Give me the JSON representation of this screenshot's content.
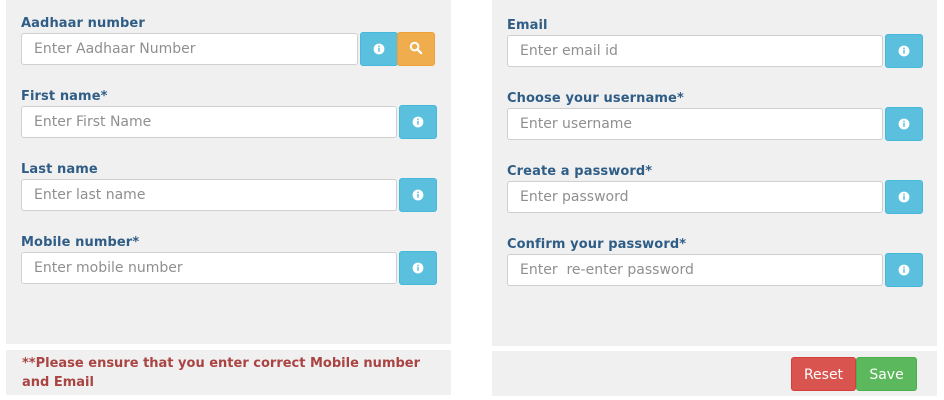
{
  "left_form": {
    "aadhaar": {
      "label": "Aadhaar number",
      "placeholder": "Enter Aadhaar Number"
    },
    "first_name": {
      "label": "First name*",
      "placeholder": "Enter First Name"
    },
    "last_name": {
      "label": "Last name",
      "placeholder": "Enter last name"
    },
    "mobile": {
      "label": "Mobile number*",
      "placeholder": "Enter mobile number"
    }
  },
  "right_form": {
    "email": {
      "label": "Email",
      "placeholder": "Enter email id"
    },
    "username": {
      "label": "Choose your username*",
      "placeholder": "Enter username"
    },
    "password": {
      "label": "Create a password*",
      "placeholder": "Enter password"
    },
    "confirm_password": {
      "label": "Confirm your password*",
      "placeholder": "Enter  re-enter password"
    }
  },
  "note": {
    "text": "**Please ensure that you enter correct Mobile number and Email"
  },
  "actions": {
    "reset_label": "Reset",
    "save_label": "Save"
  },
  "icons": {
    "info": "info-icon",
    "search": "search-icon"
  },
  "colors": {
    "label": "#2f5d86",
    "note": "#a94442",
    "info_button": "#5bc0de",
    "search_button": "#f0ad4e",
    "reset_button": "#d9534f",
    "save_button": "#5cb85c",
    "panel_background": "#f0f0f0"
  }
}
